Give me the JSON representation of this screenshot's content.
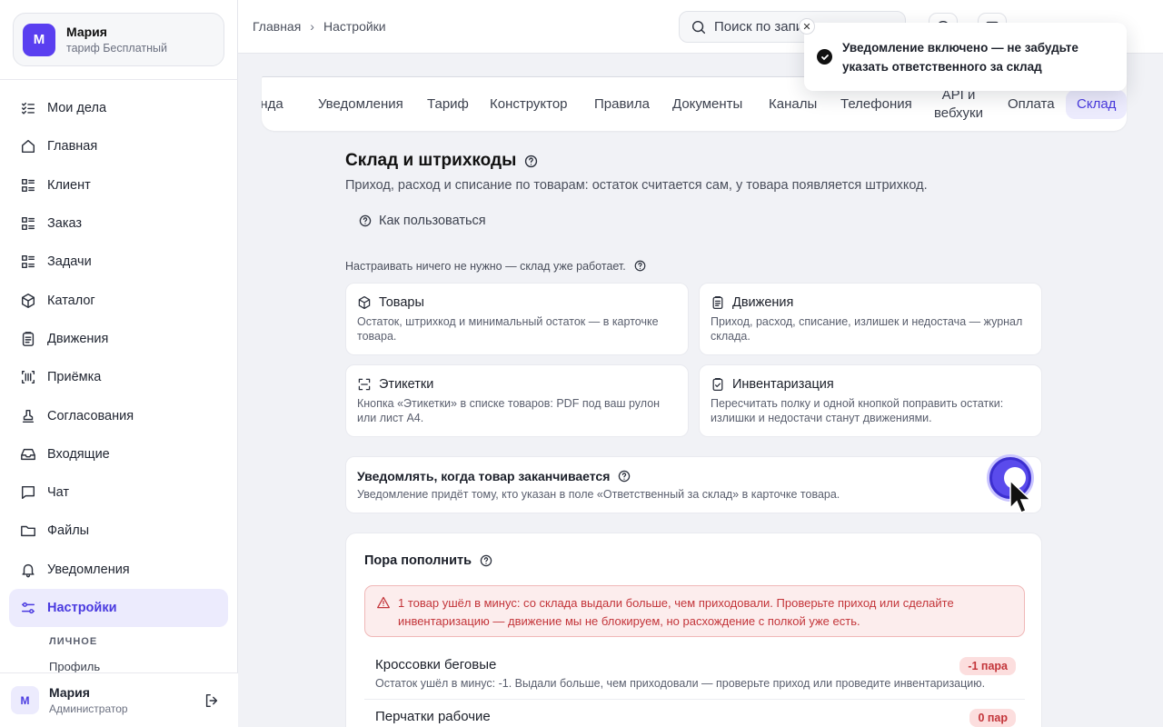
{
  "account": {
    "avatar": "М",
    "name": "Мария",
    "plan": "тариф Бесплатный"
  },
  "sidebar": {
    "items": [
      {
        "label": "Мои дела",
        "icon": "checklist-icon"
      },
      {
        "label": "Главная",
        "icon": "home-icon"
      },
      {
        "label": "Клиент",
        "icon": "list-icon"
      },
      {
        "label": "Заказ",
        "icon": "list-icon"
      },
      {
        "label": "Задачи",
        "icon": "list-icon"
      },
      {
        "label": "Каталог",
        "icon": "box-icon"
      },
      {
        "label": "Движения",
        "icon": "clipboard-icon"
      },
      {
        "label": "Приёмка",
        "icon": "barcode-icon"
      },
      {
        "label": "Согласования",
        "icon": "stamp-icon"
      },
      {
        "label": "Входящие",
        "icon": "inbox-icon"
      },
      {
        "label": "Чат",
        "icon": "chat-icon"
      },
      {
        "label": "Файлы",
        "icon": "folder-icon"
      },
      {
        "label": "Уведомления",
        "icon": "bell-icon"
      },
      {
        "label": "Настройки",
        "icon": "sliders-icon",
        "active": true
      }
    ],
    "group_label": "ЛИЧНОЕ",
    "sub_item": "Профиль"
  },
  "user": {
    "avatar": "М",
    "name": "Мария",
    "role": "Администратор"
  },
  "breadcrumb": {
    "home": "Главная",
    "current": "Настройки"
  },
  "search": {
    "placeholder": "Поиск по запи"
  },
  "toast": {
    "message": "Уведомление включено — не забудьте указать ответственного за склад"
  },
  "tabs": [
    {
      "label": "анда"
    },
    {
      "label": "Уведомления"
    },
    {
      "label": "Тариф"
    },
    {
      "label": "Конструктор"
    },
    {
      "label": "Правила"
    },
    {
      "label": "Документы"
    },
    {
      "label": "Каналы"
    },
    {
      "label": "Телефония"
    },
    {
      "label": "API и вебхуки"
    },
    {
      "label": "Оплата"
    },
    {
      "label": "Склад",
      "active": true
    }
  ],
  "page": {
    "title": "Склад и штрихкоды",
    "subtitle": "Приход, расход и списание по товарам: остаток считается сам, у товара появляется штрихкод.",
    "howto": "Как пользоваться",
    "note": "Настраивать ничего не нужно — склад уже работает."
  },
  "cards": [
    {
      "title": "Товары",
      "icon": "box-icon",
      "desc": "Остаток, штрихкод и минимальный остаток — в карточке товара."
    },
    {
      "title": "Движения",
      "icon": "clipboard-icon",
      "desc": "Приход, расход, списание, излишек и недостача — журнал склада."
    },
    {
      "title": "Этикетки",
      "icon": "scan-icon",
      "desc": "Кнопка «Этикетки» в списке товаров: PDF под ваш рулон или лист А4."
    },
    {
      "title": "Инвентаризация",
      "icon": "clipboard-check-icon",
      "desc": "Пересчитать полку и одной кнопкой поправить остатки: излишки и недостачи станут движениями."
    }
  ],
  "notify": {
    "title": "Уведомлять, когда товар заканчивается",
    "desc": "Уведомление придёт тому, кто указан в поле «Ответственный за склад» в карточке товара.",
    "enabled": true
  },
  "restock": {
    "title": "Пора пополнить",
    "alert": "1 товар ушёл в минус: со склада выдали больше, чем приходовали. Проверьте приход или сделайте инвентаризацию — движение мы не блокируем, но расхождение с полкой уже есть.",
    "items": [
      {
        "name": "Кроссовки беговые",
        "info": "Остаток ушёл в минус: -1. Выдали больше, чем приходовали — проверьте приход или проведите инвентаризацию.",
        "badge": "-1 пара"
      },
      {
        "name": "Перчатки рабочие",
        "info": "",
        "badge": "0 пар"
      }
    ]
  },
  "colors": {
    "accent": "#5a4bec",
    "active_bg": "#ecebfd",
    "danger": "#c3353a"
  }
}
